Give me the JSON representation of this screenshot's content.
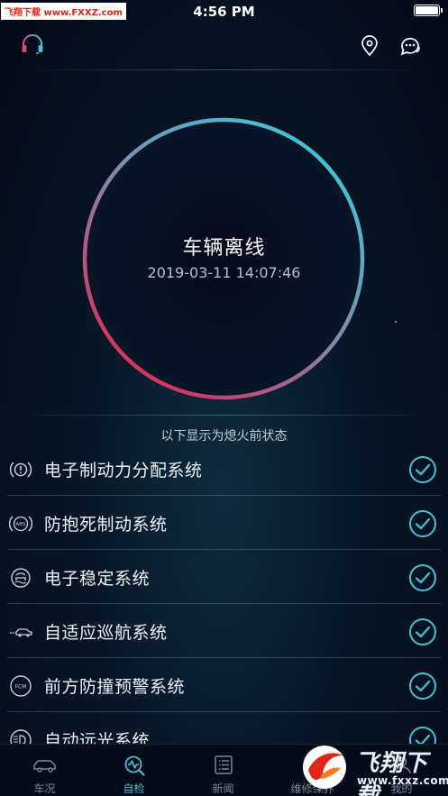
{
  "statusbar": {
    "watermark": "飞翔下载 www.FXXZ.com",
    "time": "4:56 PM"
  },
  "status": {
    "title": "车辆离线",
    "timestamp": "2019-03-11 14:07:46"
  },
  "hint": "以下显示为熄火前状态",
  "systems": [
    {
      "label": "电子制动力分配系统",
      "icon": "ebd-icon",
      "checked": true
    },
    {
      "label": "防抱死制动系统",
      "icon": "abs-icon",
      "checked": true
    },
    {
      "label": "电子稳定系统",
      "icon": "esp-icon",
      "checked": true
    },
    {
      "label": "自适应巡航系统",
      "icon": "acc-icon",
      "checked": true
    },
    {
      "label": "前方防撞预警系统",
      "icon": "fcm-icon",
      "checked": true
    },
    {
      "label": "自动远光系统",
      "icon": "high-beam-icon",
      "checked": true
    }
  ],
  "icon_text": {
    "abs": "ABS",
    "fcm": "FCM"
  },
  "tabs": [
    {
      "label": "车况",
      "icon": "car-icon",
      "active": false
    },
    {
      "label": "自检",
      "icon": "self-check-icon",
      "active": true
    },
    {
      "label": "新闻",
      "icon": "news-icon",
      "active": false
    },
    {
      "label": "维修保养",
      "icon": "maintenance-icon",
      "active": false
    },
    {
      "label": "我的",
      "icon": "profile-icon",
      "active": false
    }
  ],
  "brand_watermark": {
    "title": "飞翔下载",
    "url": "www.fxxz.com"
  },
  "colors": {
    "accent": "#3fc4d6",
    "ring_start": "#3fc4d6",
    "ring_end": "#d8305a",
    "background": "#05091a"
  }
}
